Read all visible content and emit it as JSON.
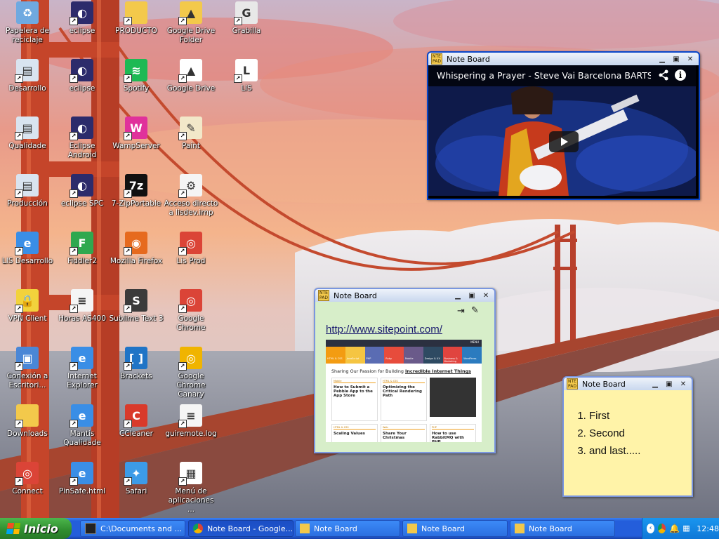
{
  "desktop": {
    "icons": [
      {
        "label": "Papelera de reciclaje",
        "icon": "recycle-bin-icon",
        "color": "#6fa9e0",
        "glyph": "♻"
      },
      {
        "label": "eclipse",
        "icon": "eclipse-icon",
        "color": "#2c2b6b",
        "glyph": "◐"
      },
      {
        "label": "PRODUCTO",
        "icon": "folder-icon",
        "color": "#f3c94b",
        "glyph": ""
      },
      {
        "label": "Google Drive Folder",
        "icon": "google-drive-folder-icon",
        "color": "#f3c94b",
        "glyph": "▲"
      },
      {
        "label": "Grabilla",
        "icon": "grabilla-icon",
        "color": "#e8e8e8",
        "glyph": "G"
      },
      {
        "label": "Desarrollo",
        "icon": "remote-desktop-icon",
        "color": "#d9e4f0",
        "glyph": "▤"
      },
      {
        "label": "eclipse",
        "icon": "eclipse-icon",
        "color": "#2c2b6b",
        "glyph": "◐"
      },
      {
        "label": "Spotify",
        "icon": "spotify-icon",
        "color": "#1db954",
        "glyph": "≋"
      },
      {
        "label": "Google Drive",
        "icon": "google-drive-icon",
        "color": "#ffffff",
        "glyph": "▲"
      },
      {
        "label": "LIS",
        "icon": "lis-icon",
        "color": "#ffffff",
        "glyph": "L"
      },
      {
        "label": "Qualidade",
        "icon": "remote-desktop-icon",
        "color": "#d9e4f0",
        "glyph": "▤"
      },
      {
        "label": "Eclipse Android",
        "icon": "eclipse-icon",
        "color": "#2c2b6b",
        "glyph": "◐"
      },
      {
        "label": "WampServer",
        "icon": "wampserver-icon",
        "color": "#e0319b",
        "glyph": "W"
      },
      {
        "label": "Paint",
        "icon": "paint-icon",
        "color": "#f2e8c9",
        "glyph": "✎"
      },
      {
        "label": "Producción",
        "icon": "remote-desktop-icon",
        "color": "#d9e4f0",
        "glyph": "▤"
      },
      {
        "label": "eclipse SPC",
        "icon": "eclipse-icon",
        "color": "#2c2b6b",
        "glyph": "◐"
      },
      {
        "label": "7-ZipPortable",
        "icon": "7zip-icon",
        "color": "#111111",
        "glyph": "7z"
      },
      {
        "label": "Acceso directo a lisdev.irnp",
        "icon": "file-shortcut-icon",
        "color": "#f5f5f5",
        "glyph": "⚙"
      },
      {
        "label": "LIS Desarrollo",
        "icon": "internet-explorer-icon",
        "color": "#3a8ee6",
        "glyph": "e"
      },
      {
        "label": "Fiddler2",
        "icon": "fiddler-icon",
        "color": "#2fa84f",
        "glyph": "F"
      },
      {
        "label": "Mozilla Firefox",
        "icon": "firefox-icon",
        "color": "#e66a1e",
        "glyph": "◉"
      },
      {
        "label": "Lis Prod",
        "icon": "chrome-icon",
        "color": "#db4437",
        "glyph": "◎"
      },
      {
        "label": "VPN Client",
        "icon": "vpn-client-icon",
        "color": "#f2d23c",
        "glyph": "🔒"
      },
      {
        "label": "Horas AS400",
        "icon": "document-icon",
        "color": "#f5f5f5",
        "glyph": "≡"
      },
      {
        "label": "Sublime Text 3",
        "icon": "sublime-text-icon",
        "color": "#3b3b3b",
        "glyph": "S"
      },
      {
        "label": "Google Chrome",
        "icon": "chrome-icon",
        "color": "#db4437",
        "glyph": "◎"
      },
      {
        "label": "Conexión a Escritori...",
        "icon": "remote-connection-icon",
        "color": "#4a87d6",
        "glyph": "▣"
      },
      {
        "label": "Internet Explorer",
        "icon": "internet-explorer-icon",
        "color": "#3a8ee6",
        "glyph": "e"
      },
      {
        "label": "Brackets",
        "icon": "brackets-icon",
        "color": "#1f74c6",
        "glyph": "[ ]"
      },
      {
        "label": "Google Chrome Canary",
        "icon": "chrome-canary-icon",
        "color": "#f0b400",
        "glyph": "◎"
      },
      {
        "label": "Downloads",
        "icon": "folder-icon",
        "color": "#f3c94b",
        "glyph": ""
      },
      {
        "label": "Mantis Qualidade",
        "icon": "internet-explorer-icon",
        "color": "#3a8ee6",
        "glyph": "e"
      },
      {
        "label": "CCleaner",
        "icon": "ccleaner-icon",
        "color": "#d93a2b",
        "glyph": "C"
      },
      {
        "label": "guiremote.log",
        "icon": "text-file-icon",
        "color": "#f5f5f5",
        "glyph": "≡"
      },
      {
        "label": "Connect",
        "icon": "chrome-icon",
        "color": "#db4437",
        "glyph": "◎"
      },
      {
        "label": "PinSafe.html",
        "icon": "internet-explorer-icon",
        "color": "#3a8ee6",
        "glyph": "e"
      },
      {
        "label": "Safari",
        "icon": "safari-icon",
        "color": "#3c9be8",
        "glyph": "✦"
      },
      {
        "label": "Menú de aplicaciones ...",
        "icon": "app-launcher-icon",
        "color": "#ffffff",
        "glyph": "▦"
      }
    ]
  },
  "windows": {
    "video": {
      "title": "Note Board",
      "video_title": "Whispering a Prayer - Steve Vai Barcelona BARTS...",
      "share_icon": "share-icon",
      "info_icon": "info-icon",
      "play_icon": "play-icon"
    },
    "sitepoint": {
      "title": "Note Board",
      "link": "http://www.sitepoint.com/",
      "thumb_tagline_prefix": "Sharing Our Passion for Building ",
      "thumb_tagline_emph": "Incredible Internet Things",
      "thumb_cards": [
        {
          "tag": "Mobile",
          "title": "How to Submit a Pebble App to the App Store"
        },
        {
          "tag": "HTML & CSS",
          "title": "Optimizing the Critical Rendering Path"
        },
        {
          "tag": "",
          "title": ""
        },
        {
          "tag": "HTML & CSS",
          "title": "Scaling Values"
        },
        {
          "tag": "Web",
          "title": "Share Your Christmas"
        },
        {
          "tag": "PHP",
          "title": "How to use RabbitMQ with PHP"
        }
      ],
      "thumb_nav": [
        "HTML & CSS",
        "JavaScript",
        "PHP",
        "Ruby",
        "Mobile",
        "Design & UX",
        "Business & Marketing",
        "WordPress"
      ],
      "thumb_menu": "MENU"
    },
    "notes": {
      "title": "Note Board",
      "items": [
        "First",
        "Second",
        "and last....."
      ]
    }
  },
  "taskbar": {
    "start_label": "Inicio",
    "buttons": [
      {
        "label": "C:\\Documents and ...",
        "icon": "cmd-icon"
      },
      {
        "label": "Note Board - Google...",
        "icon": "chrome-icon"
      },
      {
        "label": "Note Board",
        "icon": "note-board-icon"
      },
      {
        "label": "Note Board",
        "icon": "note-board-icon"
      },
      {
        "label": "Note Board",
        "icon": "note-board-icon"
      }
    ],
    "clock": "12:48"
  },
  "colors": {
    "taskbar": "#245edb",
    "start": "#3c9a3c",
    "note_yellow": "#fff3a8",
    "note_green": "#d7eec9"
  }
}
